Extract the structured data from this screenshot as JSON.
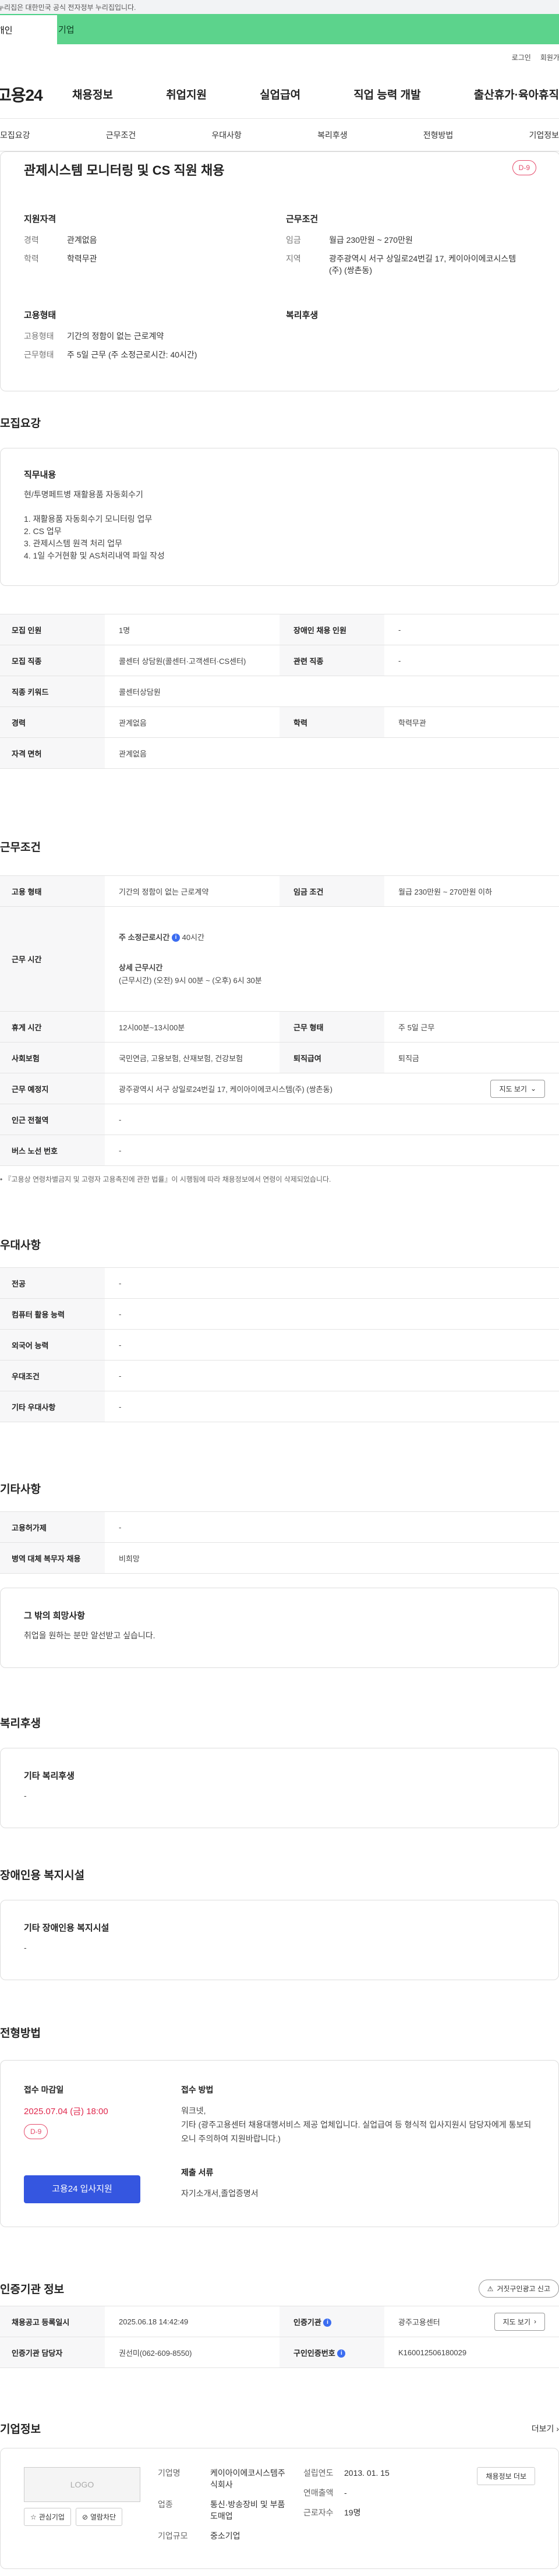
{
  "gov_notice": "누리집은 대한민국 공식 전자정부 누리집입니다.",
  "audience_tabs": {
    "personal": "개인",
    "corporate": "기업"
  },
  "util_links": [
    "로그인",
    "회원가입"
  ],
  "logo": "고용24",
  "gnb": [
    "채용정보",
    "취업지원",
    "실업급여",
    "직업 능력 개발",
    "출산휴가·육아휴직"
  ],
  "anchor_tabs": [
    "모집요강",
    "근무조건",
    "우대사항",
    "복리후생",
    "전형방법",
    "기업정보"
  ],
  "summary": {
    "title": "관제시스템 모니터링 및 CS 직원 채용",
    "dday": "D-9",
    "qualification": {
      "heading": "지원자격",
      "items": [
        {
          "k": "경력",
          "v": "관계없음"
        },
        {
          "k": "학력",
          "v": "학력무관"
        }
      ]
    },
    "conditions": {
      "heading": "근무조건",
      "items": [
        {
          "k": "임금",
          "v": "월급 230만원 ~ 270만원"
        },
        {
          "k": "지역",
          "v": "광주광역시 서구 상일로24번길 17, 케이아이에코시스템(주) (쌍촌동)"
        }
      ]
    },
    "employment": {
      "heading": "고용형태",
      "items": [
        {
          "k": "고용형태",
          "v": "기간의 정함이 없는 근로계약"
        },
        {
          "k": "근무형태",
          "v": "주 5일 근무 (주 소정근로시간: 40시간)"
        }
      ]
    },
    "welfare": {
      "heading": "복리후생"
    }
  },
  "recruit": {
    "title": "모집요강",
    "duty_heading": "직무내용",
    "duty_text": "현/투명페트병 재활용품 자동회수기\n\n1. 재활용품 자동회수기 모니터링 업무\n2. CS 업무\n3. 관제시스템 원격 처리 업무\n4. 1일 수거현황 및 AS처리내역 파일 작성",
    "rows": [
      {
        "k1": "모집 인원",
        "v1": "1명",
        "k2": "장애인 채용 인원",
        "v2": "-"
      },
      {
        "k1": "모집 직종",
        "v1": "콜센터 상담원(콜센터·고객센터·CS센터)",
        "k2": "관련 직종",
        "v2": "-"
      },
      {
        "k1": "직종 키워드",
        "v1": "콜센터상담원"
      },
      {
        "k1": "경력",
        "v1": "관계없음",
        "k2": "학력",
        "v2": "학력무관"
      },
      {
        "k1": "자격 면허",
        "v1": "관계없음"
      }
    ]
  },
  "work": {
    "title": "근무조건",
    "employ_type_label": "고용 형태",
    "employ_type": "기간의 정함이 없는 근로계약",
    "wage_label": "임금 조건",
    "wage": "월급 230만원 ~ 270만원 이하",
    "hours_label": "근무 시간",
    "weekly_hours_label": "주 소정근로시간",
    "weekly_hours": "40시간",
    "detail_label": "상세 근무시간",
    "detail": "(근무시간) (오전) 9시 00분 ~ (오후) 6시 30분",
    "break_label": "휴게 시간",
    "break": "12시00분~13시00분",
    "work_form_label": "근무 형태",
    "work_form": "주 5일 근무",
    "insurance_label": "사회보험",
    "insurance": "국민연금, 고용보험, 산재보험, 건강보험",
    "severance_label": "퇴직급여",
    "severance": "퇴직금",
    "place_label": "근무 예정지",
    "place": "광주광역시 서구 상일로24번길 17, 케이아이에코시스템(주) (쌍촌동)",
    "map_button": "지도 보기",
    "subway_label": "인근 전철역",
    "subway": "-",
    "bus_label": "버스 노선 번호",
    "bus": "-",
    "note": "『고용상 연령차별금지 및 고령자 고용촉진에 관한 법률』이 시행됨에 따라 채용정보에서 연령이 삭제되었습니다."
  },
  "preference": {
    "title": "우대사항",
    "rows": [
      {
        "k": "전공",
        "v": "-"
      },
      {
        "k": "컴퓨터 활용 능력",
        "v": "-"
      },
      {
        "k": "외국어 능력",
        "v": "-"
      },
      {
        "k": "우대조건",
        "v": "-"
      },
      {
        "k": "기타 우대사항",
        "v": "-"
      }
    ]
  },
  "etc": {
    "title": "기타사항",
    "rows": [
      {
        "k": "고용허가제",
        "v": "-"
      },
      {
        "k": "병역 대체 복무자 채용",
        "v": "비희망"
      }
    ],
    "other_heading": "그 밖의 희망사항",
    "other_text": "취업을 원하는 분만 알선받고 싶습니다."
  },
  "welfare": {
    "title": "복리후생",
    "heading": "기타 복리후생",
    "text": "-"
  },
  "disabled": {
    "title": "장애인용 복지시설",
    "heading": "기타 장애인용 복지시설",
    "text": "-"
  },
  "apply": {
    "title": "전형방법",
    "deadline_label": "접수 마감일",
    "deadline": "2025.07.04 (금) 18:00",
    "dday": "D-9",
    "apply_button": "고용24 입사지원",
    "method_label": "접수 방법",
    "method_text": "워크넷,\n기타 (광주고용센터 채용대행서비스 제공 업체입니다. 실업급여 등 형식적 입사지원시 담당자에게 통보되오니 주의하여 지원바랍니다.)",
    "docs_label": "제출 서류",
    "docs_text": "자기소개서,졸업증명서"
  },
  "cert": {
    "title": "인증기관 정보",
    "report_button": "거짓구인광고 신고",
    "rows": [
      {
        "k1": "채용공고 등록일시",
        "v1": "2025.06.18 14:42:49",
        "k2": "인증기관",
        "v2": "광주고용센터"
      },
      {
        "k1": "인증기관 담당자",
        "v1": "권선미(062-609-8550)",
        "k2": "구인인증번호",
        "v2": "K160012506180029"
      }
    ],
    "map_button": "지도 보기"
  },
  "company": {
    "title": "기업정보",
    "more": "더보기",
    "logo_text": "LOGO",
    "fav_button": "관심기업",
    "block_button": "열람차단",
    "name_label": "기업명",
    "name": "케이아이에코시스템주식회사",
    "industry_label": "업종",
    "industry": "통신·방송장비 및 부품 도매업",
    "size_label": "기업규모",
    "size": "중소기업",
    "founded_label": "설립연도",
    "founded": "2013. 01. 15",
    "revenue_label": "연매출액",
    "revenue": "-",
    "employees_label": "근로자수",
    "employees": "19명",
    "jobs_button": "채용정보 더보"
  }
}
